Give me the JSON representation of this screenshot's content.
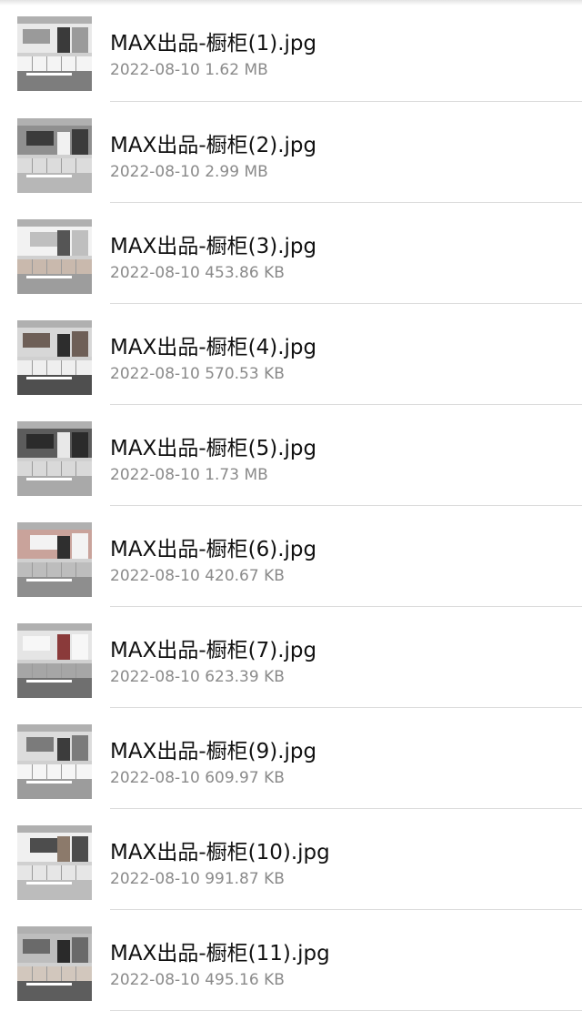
{
  "files": [
    {
      "name": "MAX出品-橱柜(1).jpg",
      "date": "2022-08-10",
      "size": "1.62 MB",
      "thumb_icon": "kitchen-photo-icon"
    },
    {
      "name": "MAX出品-橱柜(2).jpg",
      "date": "2022-08-10",
      "size": "2.99 MB",
      "thumb_icon": "kitchen-photo-icon"
    },
    {
      "name": "MAX出品-橱柜(3).jpg",
      "date": "2022-08-10",
      "size": "453.86 KB",
      "thumb_icon": "kitchen-photo-icon"
    },
    {
      "name": "MAX出品-橱柜(4).jpg",
      "date": "2022-08-10",
      "size": "570.53 KB",
      "thumb_icon": "kitchen-photo-icon"
    },
    {
      "name": "MAX出品-橱柜(5).jpg",
      "date": "2022-08-10",
      "size": "1.73 MB",
      "thumb_icon": "kitchen-photo-icon"
    },
    {
      "name": "MAX出品-橱柜(6).jpg",
      "date": "2022-08-10",
      "size": "420.67 KB",
      "thumb_icon": "kitchen-photo-icon"
    },
    {
      "name": "MAX出品-橱柜(7).jpg",
      "date": "2022-08-10",
      "size": "623.39 KB",
      "thumb_icon": "kitchen-photo-icon"
    },
    {
      "name": "MAX出品-橱柜(9).jpg",
      "date": "2022-08-10",
      "size": "609.97 KB",
      "thumb_icon": "kitchen-photo-icon"
    },
    {
      "name": "MAX出品-橱柜(10).jpg",
      "date": "2022-08-10",
      "size": "991.87 KB",
      "thumb_icon": "kitchen-photo-icon"
    },
    {
      "name": "MAX出品-橱柜(11).jpg",
      "date": "2022-08-10",
      "size": "495.16 KB",
      "thumb_icon": "kitchen-photo-icon"
    }
  ],
  "colors": {
    "name_text": "#111111",
    "meta_text": "#8a8a8a",
    "divider": "#dcdcdc",
    "background": "#ffffff"
  }
}
